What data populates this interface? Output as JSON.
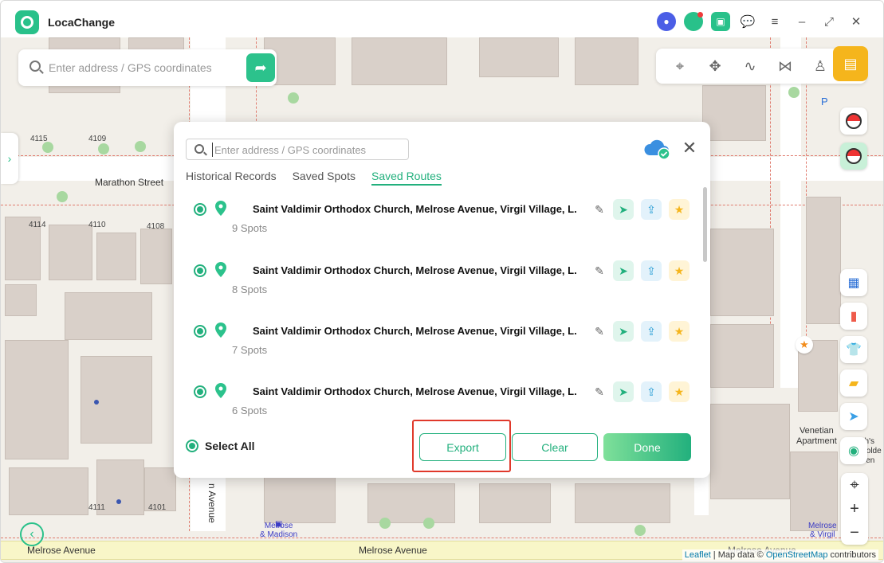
{
  "app": {
    "title": "LocaChange"
  },
  "map_search": {
    "placeholder": "Enter address / GPS coordinates"
  },
  "map": {
    "labels": {
      "marathon_street": "Marathon Street",
      "melrose_avenue_left": "Melrose Avenue",
      "melrose_avenue_center": "Melrose Avenue",
      "melrose_avenue_right": "Melrose Avenue",
      "n_avenue": "n Avenue",
      "venetian": "Venetian\nApartment",
      "golden": "ah's\nGolde\nHen",
      "bus_left": "Melrose\n& Madison",
      "bus_right": "Melrose\n& Virgil",
      "parking": "P"
    },
    "numbers": {
      "n4115": "4115",
      "n4109": "4109",
      "n4114": "4114",
      "n4110": "4110",
      "n4108": "4108",
      "n4111": "4111",
      "n4101": "4101"
    },
    "attribution": {
      "leaflet": "Leaflet",
      "middle": " | Map data © ",
      "osm": "OpenStreetMap",
      "end": " contributors"
    }
  },
  "modal": {
    "search_placeholder": "Enter address / GPS coordinates",
    "tabs": [
      {
        "label": "Historical Records",
        "active": false
      },
      {
        "label": "Saved Spots",
        "active": false
      },
      {
        "label": "Saved Routes",
        "active": true
      }
    ],
    "routes": [
      {
        "title": "Saint Valdimir Orthodox Church, Melrose Avenue, Virgil Village, L.",
        "spots": "9 Spots"
      },
      {
        "title": "Saint Valdimir Orthodox Church, Melrose Avenue, Virgil Village, L.",
        "spots": "8 Spots"
      },
      {
        "title": "Saint Valdimir Orthodox Church, Melrose Avenue, Virgil Village, L.",
        "spots": "7 Spots"
      },
      {
        "title": "Saint Valdimir Orthodox Church, Melrose Avenue, Virgil Village, L.",
        "spots": "6 Spots"
      }
    ],
    "select_all_label": "Select All",
    "export_label": "Export",
    "clear_label": "Clear",
    "done_label": "Done"
  },
  "colors": {
    "accent": "#22b07d",
    "highlight": "#e0392b",
    "mode_active": "#f5b51c"
  }
}
